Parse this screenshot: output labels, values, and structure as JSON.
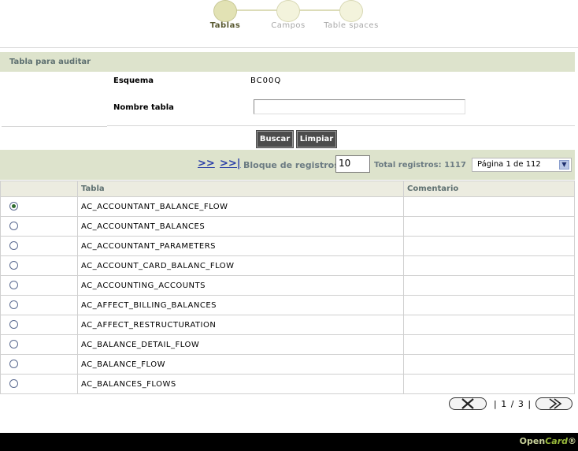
{
  "wizard": {
    "steps": [
      {
        "label": "Tablas"
      },
      {
        "label": "Campos"
      },
      {
        "label": "Table spaces"
      }
    ]
  },
  "form": {
    "section_title": "Tabla para auditar",
    "schema_label": "Esquema",
    "schema_value": "BC00Q",
    "table_name_label": "Nombre tabla",
    "table_name_value": ""
  },
  "buttons": {
    "search": "Buscar",
    "clear": "Limpiar"
  },
  "pager": {
    "next_link": ">>",
    "last_link": ">>|",
    "block_label": "Bloque de registros:",
    "block_value": "10",
    "total_label": "Total registros: 1117",
    "page_select": "Página 1 de 112"
  },
  "table": {
    "columns": [
      "Tabla",
      "Comentario"
    ],
    "rows": [
      {
        "name": "AC_ACCOUNTANT_BALANCE_FLOW",
        "comment": ""
      },
      {
        "name": "AC_ACCOUNTANT_BALANCES",
        "comment": ""
      },
      {
        "name": "AC_ACCOUNTANT_PARAMETERS",
        "comment": ""
      },
      {
        "name": "AC_ACCOUNT_CARD_BALANC_FLOW",
        "comment": ""
      },
      {
        "name": "AC_ACCOUNTING_ACCOUNTS",
        "comment": ""
      },
      {
        "name": "AC_AFFECT_BILLING_BALANCES",
        "comment": ""
      },
      {
        "name": "AC_AFFECT_RESTRUCTURATION",
        "comment": ""
      },
      {
        "name": "AC_BALANCE_DETAIL_FLOW",
        "comment": ""
      },
      {
        "name": "AC_BALANCE_FLOW",
        "comment": ""
      },
      {
        "name": "AC_BALANCES_FLOWS",
        "comment": ""
      }
    ],
    "selected_row": 0
  },
  "wizard_nav": {
    "page_count": "| 1 / 3 |"
  },
  "footer": {
    "brand_part1": "Open",
    "brand_part2": "Card",
    "brand_mark": "®"
  },
  "colors": {
    "section_bar": "#dde3cc",
    "button": "#4c4c4c",
    "link": "#2b3fa8",
    "footer": "#000000"
  }
}
